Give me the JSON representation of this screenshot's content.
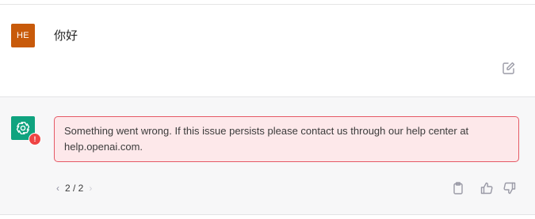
{
  "user_turn": {
    "avatar_initials": "HE",
    "message": "你好"
  },
  "assistant_turn": {
    "error_message": "Something went wrong. If this issue persists please contact us through our help center at help.openai.com.",
    "error_badge": "!",
    "pager": {
      "prev": "‹",
      "count": "2 / 2",
      "next": "›"
    }
  },
  "icons": {
    "edit": "edit-icon",
    "copy": "clipboard-icon",
    "like": "thumbs-up-icon",
    "dislike": "thumbs-down-icon",
    "bot": "openai-logo-icon"
  },
  "colors": {
    "user_avatar": "#c85a0a",
    "bot_avatar": "#10a37f",
    "error_bg": "#fde8ea",
    "error_border": "#e55a66",
    "error_badge": "#ef4444"
  }
}
